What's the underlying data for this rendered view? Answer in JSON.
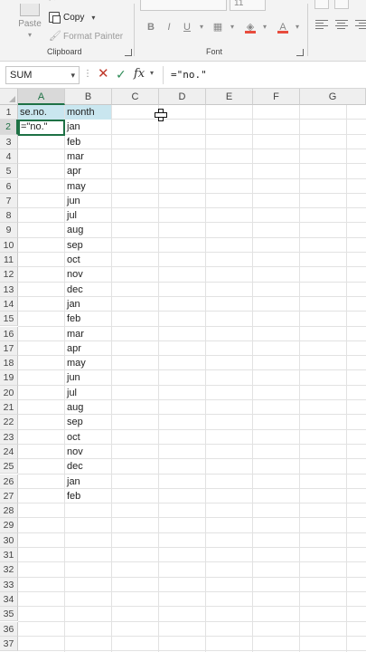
{
  "ribbon": {
    "clipboard": {
      "paste_label": "Paste",
      "copy_label": "Copy",
      "format_painter_label": "Format Painter",
      "group_label": "Clipboard"
    },
    "font": {
      "font_size": "11",
      "bold": "B",
      "italic": "I",
      "underline": "U",
      "group_label": "Font"
    }
  },
  "formula_bar": {
    "name_box": "SUM",
    "fx": "fx",
    "formula": "=\"no.\""
  },
  "grid": {
    "columns": [
      "A",
      "B",
      "C",
      "D",
      "E",
      "F",
      "G"
    ],
    "active_column": "A",
    "rows": [
      "1",
      "2",
      "3",
      "4",
      "5",
      "6",
      "7",
      "8",
      "9",
      "10",
      "11",
      "12",
      "13",
      "14",
      "15",
      "16",
      "17",
      "18",
      "19",
      "20",
      "21",
      "22",
      "23",
      "24",
      "25",
      "26",
      "27",
      "28",
      "29",
      "30",
      "31",
      "32",
      "33",
      "34",
      "35",
      "36",
      "37"
    ],
    "active_row": "2",
    "col_a": [
      "se.no.",
      "=\"no.\""
    ],
    "col_b": [
      "month",
      "jan",
      "feb",
      "mar",
      "apr",
      "may",
      "jun",
      "jul",
      "aug",
      "sep",
      "oct",
      "nov",
      "dec",
      "jan",
      "feb",
      "mar",
      "apr",
      "may",
      "jun",
      "jul",
      "aug",
      "sep",
      "oct",
      "nov",
      "dec",
      "jan",
      "feb"
    ]
  },
  "colors": {
    "accent": "#1e7145",
    "header_fill": "#c9e6ef",
    "cancel": "#c0392b",
    "enter": "#2e8b57"
  }
}
